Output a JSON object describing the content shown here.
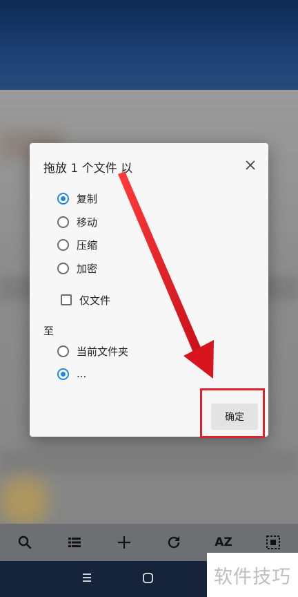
{
  "dialog": {
    "title": "拖放 1 个文件 以",
    "operations": [
      {
        "label": "复制",
        "checked": true
      },
      {
        "label": "移动",
        "checked": false
      },
      {
        "label": "压缩",
        "checked": false
      },
      {
        "label": "加密",
        "checked": false
      }
    ],
    "files_only_label": "仅文件",
    "files_only_checked": false,
    "to_label": "至",
    "destinations": [
      {
        "label": "当前文件夹",
        "checked": false
      },
      {
        "label": "...",
        "checked": true
      }
    ],
    "ok_label": "确定"
  },
  "toolbar": {
    "items": [
      "search-icon",
      "list-view-icon",
      "add-icon",
      "refresh-icon",
      "AZ",
      "select-all-icon"
    ],
    "sort_label": "AZ"
  },
  "navbar": {
    "items": [
      "menu-icon",
      "home-icon"
    ]
  },
  "watermark": {
    "text": "软件技巧"
  },
  "colors": {
    "accent": "#1e88e5",
    "highlight": "#e0202a",
    "navbar": "#16243b",
    "toolbar": "#6d6f73"
  }
}
